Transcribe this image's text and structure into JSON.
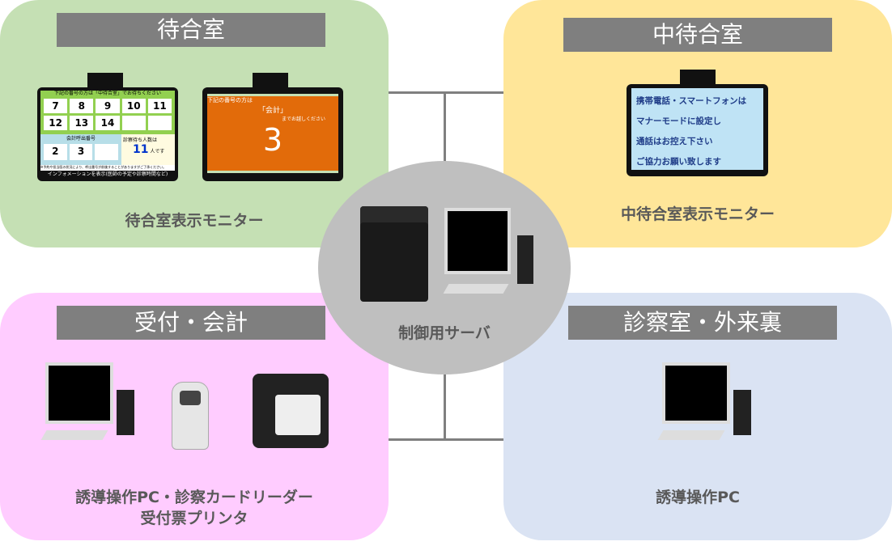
{
  "waiting_room": {
    "title": "待合室",
    "caption": "待合室表示モニター",
    "monitor1": {
      "header": "下記の番号の方は「中待合室」でお待ちください",
      "numbers": [
        "7",
        "8",
        "9",
        "10",
        "11",
        "12",
        "13",
        "14",
        "",
        ""
      ],
      "payment_label": "会計呼出番号",
      "payment_numbers": [
        "2",
        "3",
        ""
      ],
      "waiting_label": "診察待ち人数は",
      "waiting_count": "11",
      "waiting_unit": "人です",
      "notice": "※予約や担当医の状況により、呼出番号が前後することがありますがご了承ください。",
      "info": "インフォメーションを表示(医師の予定や診察時間など)"
    },
    "monitor2": {
      "line1": "下記の番号の方は",
      "line2": "「会計」",
      "line3": "までお越しください",
      "number": "3"
    }
  },
  "inner_waiting_room": {
    "title": "中待合室",
    "caption": "中待合室表示モニター",
    "monitor_lines": [
      "携帯電話・スマートフォンは",
      "マナーモードに設定し",
      "通話はお控え下さい",
      "ご協力お願い致します"
    ]
  },
  "server": {
    "caption": "制御用サーバ"
  },
  "reception": {
    "title": "受付・会計",
    "caption_lines": [
      "誘導操作PC・診察カードリーダー",
      "受付票プリンタ"
    ]
  },
  "exam_room": {
    "title": "診察室・外来裏",
    "caption": "誘導操作PC"
  },
  "colors": {
    "waiting": "#c5e0b4",
    "inner": "#ffe699",
    "reception": "#ffccff",
    "exam": "#dae3f3",
    "server": "#bfbfbf",
    "title_bar": "#7f7f7f",
    "orange_screen": "#e26b0a"
  }
}
